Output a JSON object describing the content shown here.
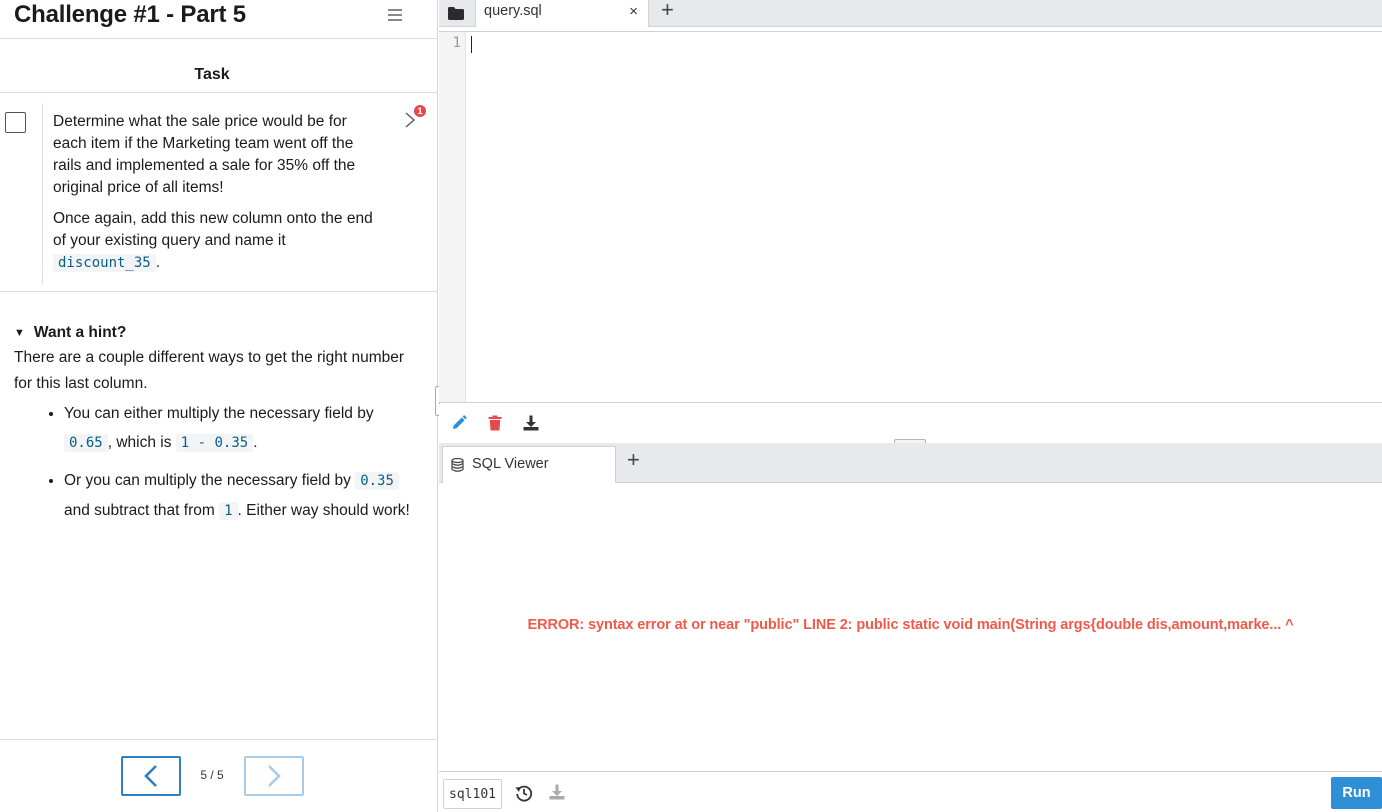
{
  "header": {
    "title": "Challenge #1 - Part 5"
  },
  "task": {
    "heading": "Task",
    "badge": "1",
    "paragraph1": "Determine what the sale price would be for each item if the Marketing team went off the rails and implemented a sale for 35% off the original price of all items!",
    "paragraph2_before": "Once again, add this new column onto the end of your existing query and name it ",
    "paragraph2_code": "discount_35",
    "paragraph2_after": "."
  },
  "hint": {
    "summary": "Want a hint?",
    "triangle": "▼",
    "intro": "There are a couple different ways to get the right number for this last column.",
    "items": [
      {
        "t1": "You can either multiply the necessary field by ",
        "c1": "0.65",
        "t2": ", which is ",
        "c2": "1 - 0.35",
        "t3": "."
      },
      {
        "t1": "Or you can multiply the necessary field by ",
        "c1": "0.35",
        "t2": " and subtract that from ",
        "c2": "1",
        "t3": ". Either way should work!"
      }
    ]
  },
  "pager": {
    "label": "5 / 5"
  },
  "editor": {
    "tab_label": "query.sql",
    "close_glyph": "×",
    "add_glyph": "+",
    "line_numbers": [
      "1"
    ]
  },
  "viewer": {
    "tab_label": "SQL Viewer",
    "add_glyph": "+",
    "error": "ERROR: syntax error at or near \"public\" LINE 2: public static void main(String args{double dis,amount,marke... ^"
  },
  "footer": {
    "db_name": "sql101",
    "run_label": "Run"
  },
  "colors": {
    "accent": "#2f8fd6",
    "error": "#f05a4b",
    "badge": "#e5484d",
    "code": "#0a5c8a"
  }
}
